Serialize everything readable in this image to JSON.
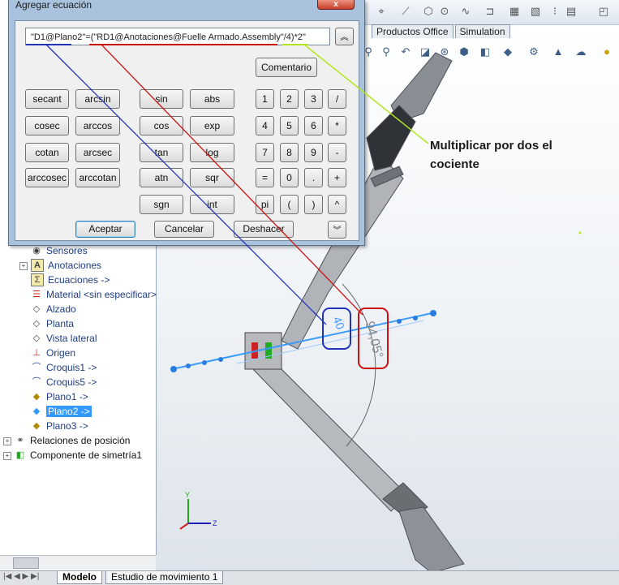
{
  "top_toolbar": {
    "tabs": [
      "Productos Office",
      "Simulation"
    ]
  },
  "dialog": {
    "title": "Agregar ecuación",
    "close": "x",
    "equation": "\"D1@Plano2\"=(\"RD1@Anotaciones@Fuelle Armado.Assembly\"/4)*2\"",
    "collapse_icon": "double-chevron-up-icon",
    "comment_label": "Comentario",
    "functions_col1": [
      "secant",
      "cosec",
      "cotan",
      "arccosec"
    ],
    "functions_col2": [
      "arcsin",
      "arccos",
      "arcsec",
      "arccotan"
    ],
    "functions_col3": [
      "sin",
      "cos",
      "tan",
      "atn",
      "sgn"
    ],
    "functions_col4": [
      "abs",
      "exp",
      "log",
      "sqr",
      "int"
    ],
    "keypad": [
      [
        "1",
        "2",
        "3",
        "/"
      ],
      [
        "4",
        "5",
        "6",
        "*"
      ],
      [
        "7",
        "8",
        "9",
        "-"
      ],
      [
        "=",
        "0",
        ".",
        "+"
      ],
      [
        "pi",
        "(",
        ")",
        "^"
      ]
    ],
    "accept_label": "Aceptar",
    "cancel_label": "Cancelar",
    "undo_label": "Deshacer",
    "expand_icon": "double-chevron-down-icon"
  },
  "annotation": {
    "text": "Multiplicar por dos el cociente"
  },
  "dimensions": {
    "angle_small": "40",
    "angle_large": "94,05°"
  },
  "tree": {
    "items": [
      {
        "label": "Sensores",
        "icon": "sensor-icon"
      },
      {
        "label": "Anotaciones",
        "icon": "annotation-icon"
      },
      {
        "label": "Ecuaciones ->",
        "icon": "sigma-icon"
      },
      {
        "label": "Material <sin especificar>",
        "icon": "material-icon"
      },
      {
        "label": "Alzado",
        "icon": "plane-icon"
      },
      {
        "label": "Planta",
        "icon": "plane-icon"
      },
      {
        "label": "Vista lateral",
        "icon": "plane-icon"
      },
      {
        "label": "Origen",
        "icon": "origin-icon"
      },
      {
        "label": "Croquis1 ->",
        "icon": "sketch-icon"
      },
      {
        "label": "Croquis5 ->",
        "icon": "sketch-icon"
      },
      {
        "label": "Plano1 ->",
        "icon": "plane-icon"
      },
      {
        "label": "Plano2 ->",
        "icon": "plane-icon",
        "selected": true
      },
      {
        "label": "Plano3 ->",
        "icon": "plane-icon"
      }
    ],
    "relations": "Relaciones de posición",
    "symmetry": "Componente de simetría1"
  },
  "bottom_tabs": [
    "Modelo",
    "Estudio de movimiento 1"
  ],
  "colors": {
    "blue_line": "#2233bb",
    "red_line": "#cc1111",
    "green_line": "#b3e619",
    "dimension_blue": "#3a9bff"
  }
}
